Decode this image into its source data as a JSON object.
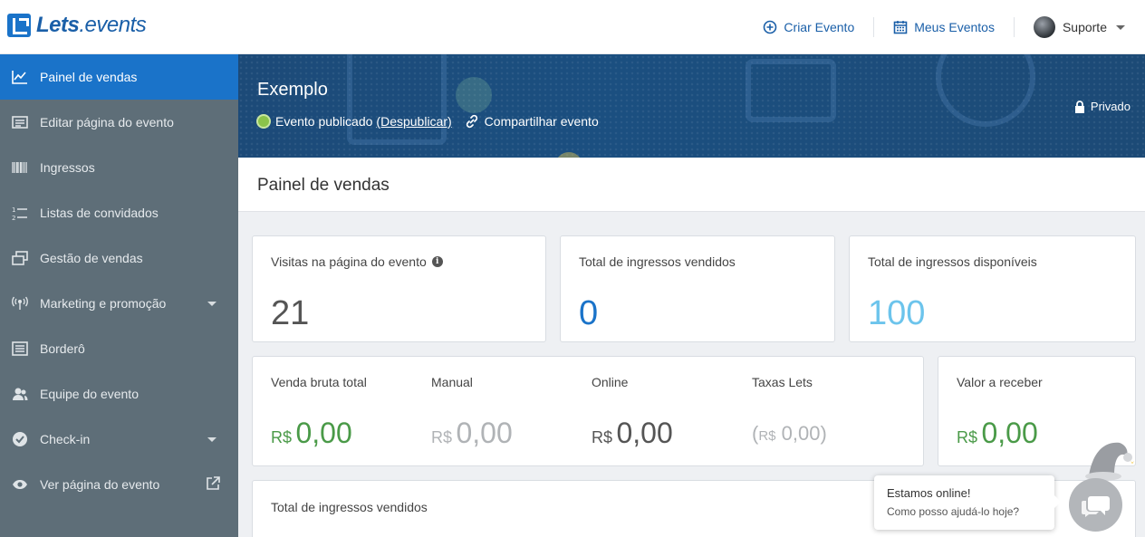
{
  "brand": {
    "name_bold": "Lets",
    "name_rest": ".events"
  },
  "topnav": {
    "create": "Criar Evento",
    "my_events": "Meus Eventos",
    "user": "Suporte"
  },
  "sidebar": {
    "items": [
      {
        "label": "Painel de vendas",
        "icon": "chart-line-icon"
      },
      {
        "label": "Editar página do evento",
        "icon": "page-icon"
      },
      {
        "label": "Ingressos",
        "icon": "barcode-icon"
      },
      {
        "label": "Listas de convidados",
        "icon": "numbered-list-icon"
      },
      {
        "label": "Gestão de vendas",
        "icon": "windows-icon"
      },
      {
        "label": "Marketing e promoção",
        "icon": "broadcast-icon"
      },
      {
        "label": "Borderô",
        "icon": "ledger-icon"
      },
      {
        "label": "Equipe do evento",
        "icon": "team-icon"
      },
      {
        "label": "Check-in",
        "icon": "check-circle-icon"
      },
      {
        "label": "Ver página do evento",
        "icon": "eye-icon"
      }
    ]
  },
  "hero": {
    "title": "Exemplo",
    "status": "Evento publicado",
    "unpublish": "(Despublicar)",
    "share": "Compartilhar evento",
    "privacy": "Privado"
  },
  "page": {
    "title": "Painel de vendas"
  },
  "stats": {
    "visits": {
      "label": "Visitas na página do evento",
      "value": "21",
      "color": "#555555"
    },
    "sold": {
      "label": "Total de ingressos vendidos",
      "value": "0",
      "color": "#1a73c9"
    },
    "available": {
      "label": "Total de ingressos disponíveis",
      "value": "100",
      "color": "#6cc4ec"
    }
  },
  "money": {
    "gross": {
      "label": "Venda bruta total",
      "currency": "R$",
      "value": "0,00"
    },
    "manual": {
      "label": "Manual",
      "currency": "R$",
      "value": "0,00"
    },
    "online": {
      "label": "Online",
      "currency": "R$",
      "value": "0,00"
    },
    "fees": {
      "label": "Taxas Lets",
      "open": "(",
      "currency": "R$",
      "value": "0,00",
      "close": ")"
    },
    "receivable": {
      "label": "Valor a receber",
      "currency": "R$",
      "value": "0,00"
    }
  },
  "chart_section": {
    "title": "Total de ingressos vendidos"
  },
  "chat": {
    "line1": "Estamos online!",
    "line2": "Como posso ajudá-lo hoje?"
  },
  "colors": {
    "accent": "#1a73c9",
    "sidebar": "#5e6e78",
    "green": "#4a9a48"
  }
}
